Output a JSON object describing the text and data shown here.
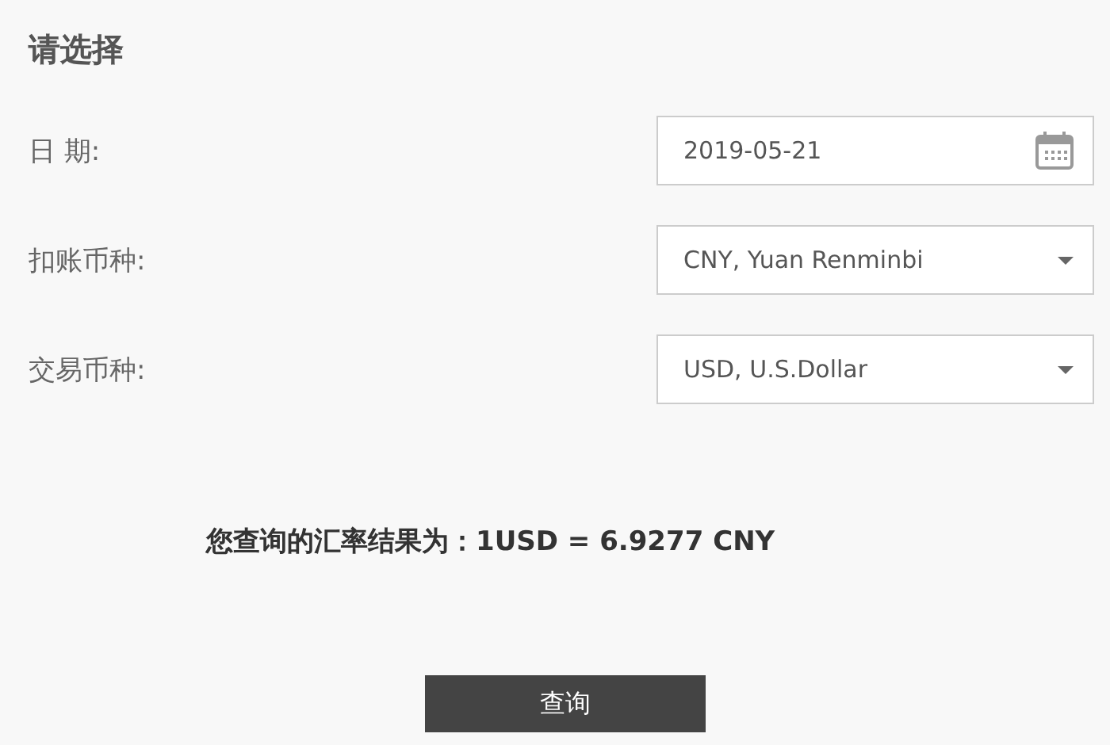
{
  "heading": "请选择",
  "fields": [
    {
      "label": "日 期:",
      "kind": "date",
      "value": "2019-05-21"
    },
    {
      "label": "扣账币种:",
      "kind": "select",
      "value": "CNY, Yuan Renminbi"
    },
    {
      "label": "交易币种:",
      "kind": "select",
      "value": "USD, U.S.Dollar"
    }
  ],
  "result": "您查询的汇率结果为：1USD = 6.9277 CNY",
  "button": "查询"
}
